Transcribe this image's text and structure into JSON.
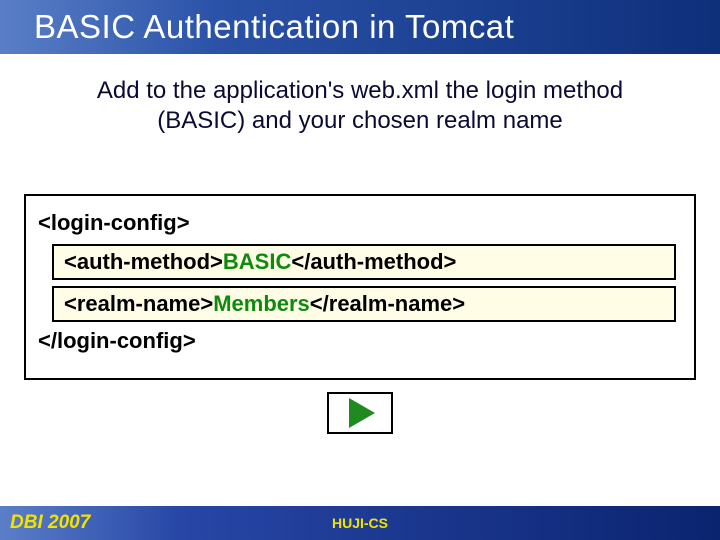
{
  "title": "BASIC Authentication in Tomcat",
  "subtitle": "Add to the application's web.xml the login method (BASIC) and your chosen realm name",
  "code": {
    "open": "<login-config>",
    "auth_pre": "<auth-method>",
    "auth_val": "BASIC",
    "auth_post": "</auth-method>",
    "realm_pre": "<realm-name>",
    "realm_val": "Members",
    "realm_post": "</realm-name>",
    "close": "</login-config>"
  },
  "footer": {
    "left": "DBI 2007",
    "center": "HUJI-CS"
  }
}
